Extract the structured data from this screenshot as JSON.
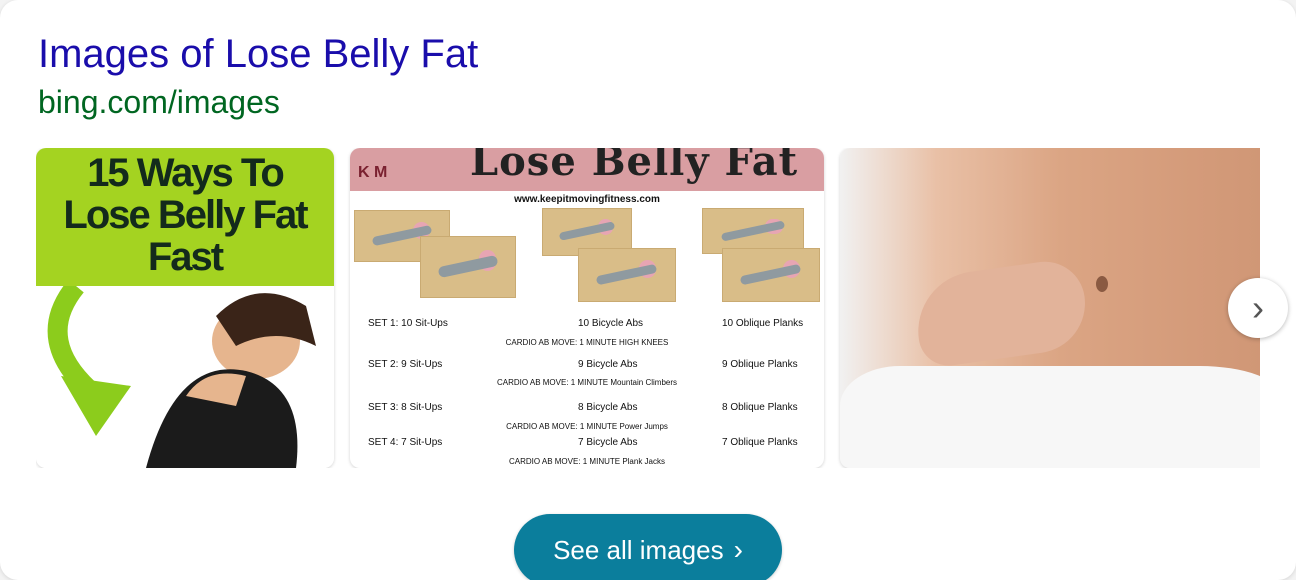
{
  "header": {
    "title": "Images of Lose Belly Fat",
    "url": "bing.com/images"
  },
  "thumbnails": [
    {
      "lines": [
        "15 Ways To",
        "Lose Belly Fat",
        "Fast"
      ]
    },
    {
      "banner": "Lose Belly Fat",
      "logo": "K M",
      "site": "www.keepitmovingfitness.com",
      "sets": [
        {
          "a": "SET 1:   10 Sit-Ups",
          "b": "10 Bicycle Abs",
          "c": "10 Oblique Planks",
          "cardio": "CARDIO AB MOVE: 1 MINUTE  HIGH KNEES"
        },
        {
          "a": "SET 2:   9 Sit-Ups",
          "b": "9 Bicycle Abs",
          "c": "9 Oblique Planks",
          "cardio": "CARDIO AB MOVE: 1 MINUTE  Mountain Climbers"
        },
        {
          "a": "SET 3:   8 Sit-Ups",
          "b": "8 Bicycle Abs",
          "c": "8 Oblique Planks",
          "cardio": "CARDIO AB MOVE: 1 MINUTE  Power Jumps"
        },
        {
          "a": "SET 4:   7 Sit-Ups",
          "b": "7 Bicycle Abs",
          "c": "7 Oblique Planks",
          "cardio": "CARDIO AB MOVE: 1 MINUTE  Plank Jacks"
        }
      ]
    },
    {}
  ],
  "next_icon": "chevron-right-icon",
  "see_all": {
    "label": "See all images",
    "icon": "chevron-right-icon"
  },
  "colors": {
    "title": "#1a0dab",
    "url": "#006621",
    "button": "#0b7e9c"
  }
}
